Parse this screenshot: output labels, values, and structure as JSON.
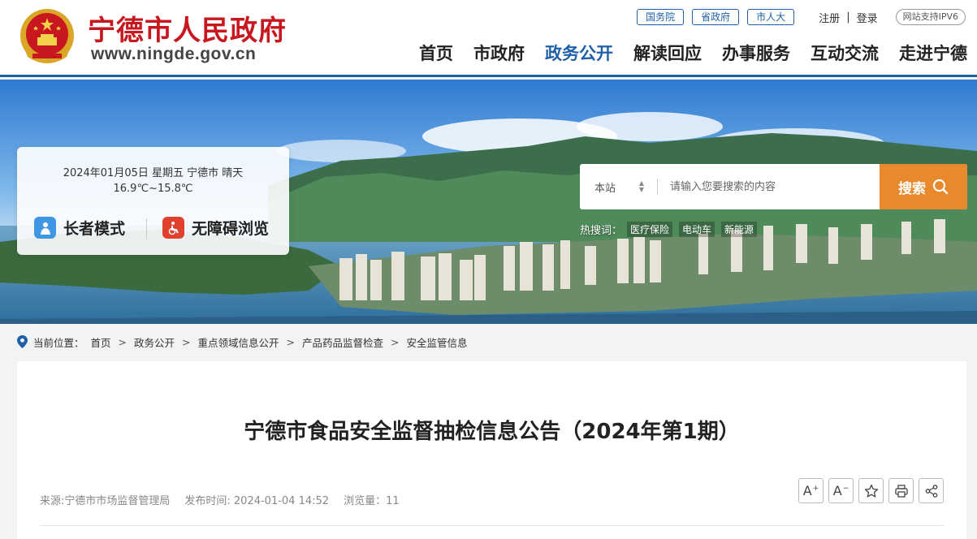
{
  "header": {
    "site_title": "宁德市人民政府",
    "site_url": "www.ningde.gov.cn",
    "top_links": [
      "国务院",
      "省政府",
      "市人大"
    ],
    "register": "注册",
    "separator": "|",
    "login": "登录",
    "ipv6": "网站支持IPV6",
    "nav": [
      {
        "label": "首页",
        "active": false
      },
      {
        "label": "市政府",
        "active": false
      },
      {
        "label": "政务公开",
        "active": true
      },
      {
        "label": "解读回应",
        "active": false
      },
      {
        "label": "办事服务",
        "active": false
      },
      {
        "label": "互动交流",
        "active": false
      },
      {
        "label": "走进宁德",
        "active": false
      }
    ]
  },
  "weather": {
    "line1": "2024年01月05日  星期五   宁德市  晴天",
    "line2": "16.9℃~15.8℃",
    "elder_mode": "长者模式",
    "accessible": "无障碍浏览"
  },
  "search": {
    "scope": "本站",
    "placeholder": "请输入您要搜索的内容",
    "button": "搜索",
    "hot_label": "热搜词：",
    "hot_tags": [
      "医疗保险",
      "电动车",
      "新能源"
    ]
  },
  "breadcrumb": {
    "label": "当前位置：",
    "items": [
      "首页",
      "政务公开",
      "重点领域信息公开",
      "产品药品监督检查",
      "安全监管信息"
    ]
  },
  "article": {
    "title": "宁德市食品安全监督抽检信息公告（2024年第1期）",
    "source": "来源:宁德市市场监督管理局",
    "published": "发布时间: 2024-01-04 14:52",
    "views": "浏览量：11"
  },
  "colors": {
    "brand_red": "#c8171f",
    "brand_blue": "#1f5fa8",
    "search_orange": "#e8892d"
  }
}
